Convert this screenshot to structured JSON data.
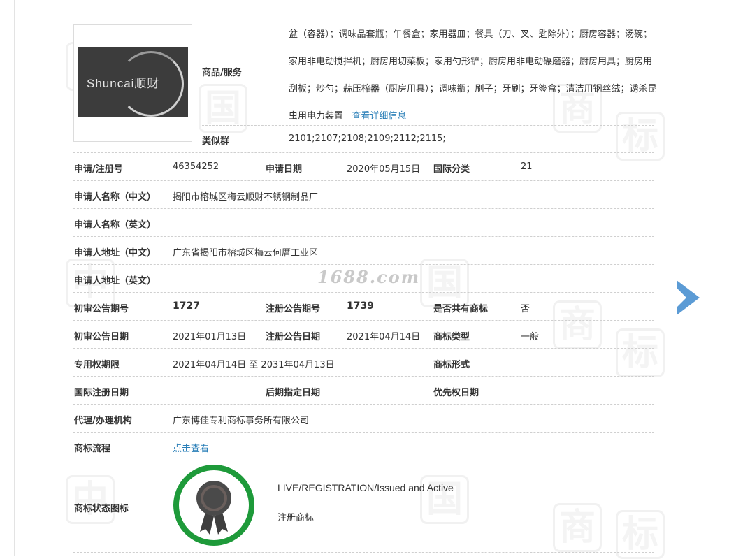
{
  "watermark": {
    "site": "1688.com",
    "glyphs": [
      "中",
      "国",
      "商",
      "标"
    ]
  },
  "trademark": {
    "logo_text": "Shuncai顺财",
    "goods_label": "商品/服务",
    "goods_text": "盆（容器）；调味品套瓶；午餐盒；家用器皿；餐具（刀、叉、匙除外）；厨房容器；汤碗；家用非电动搅拌机；厨房用切菜板；家用勺形铲；厨房用非电动碾磨器；厨房用具；厨房用刮板；炒勺；蒜压榨器（厨房用具）；调味瓶；刷子；牙刷；牙签盒；清洁用钢丝绒；诱杀昆虫用电力装置",
    "goods_link": "查看详细信息",
    "similar_label": "类似群",
    "similar_value": "2101;2107;2108;2109;2112;2115;"
  },
  "rows": {
    "reg_no_label": "申请/注册号",
    "reg_no": "46354252",
    "apply_date_label": "申请日期",
    "apply_date": "2020年05月15日",
    "intl_class_label": "国际分类",
    "intl_class": "21",
    "applicant_cn_label": "申请人名称（中文）",
    "applicant_cn": "揭阳市榕城区梅云顺财不锈钢制品厂",
    "applicant_en_label": "申请人名称（英文）",
    "applicant_en": "",
    "address_cn_label": "申请人地址（中文）",
    "address_cn": "广东省揭阳市榕城区梅云何厝工业区",
    "address_en_label": "申请人地址（英文）",
    "address_en": "",
    "prelim_no_label": "初审公告期号",
    "prelim_no": "1727",
    "reg_pub_no_label": "注册公告期号",
    "reg_pub_no": "1739",
    "shared_label": "是否共有商标",
    "shared": "否",
    "prelim_date_label": "初审公告日期",
    "prelim_date": "2021年01月13日",
    "reg_pub_date_label": "注册公告日期",
    "reg_pub_date": "2021年04月14日",
    "type_label": "商标类型",
    "type": "一般",
    "term_label": "专用权期限",
    "term": "2021年04月14日 至 2031年04月13日",
    "form_label": "商标形式",
    "form": "",
    "intl_reg_date_label": "国际注册日期",
    "intl_reg_date": "",
    "later_date_label": "后期指定日期",
    "later_date": "",
    "priority_date_label": "优先权日期",
    "priority_date": "",
    "agent_label": "代理/办理机构",
    "agent": "广东博佳专利商标事务所有限公司",
    "flow_label": "商标流程",
    "flow_link": "点击查看",
    "status_icon_label": "商标状态图标",
    "status_en": "LIVE/REGISTRATION/Issued and Active",
    "status_cn": "注册商标"
  },
  "colors": {
    "link": "#2a7fb8",
    "arrow": "#5b9bd5",
    "badge_ring": "#1e9a3a",
    "badge_core": "#4a4a4a"
  }
}
